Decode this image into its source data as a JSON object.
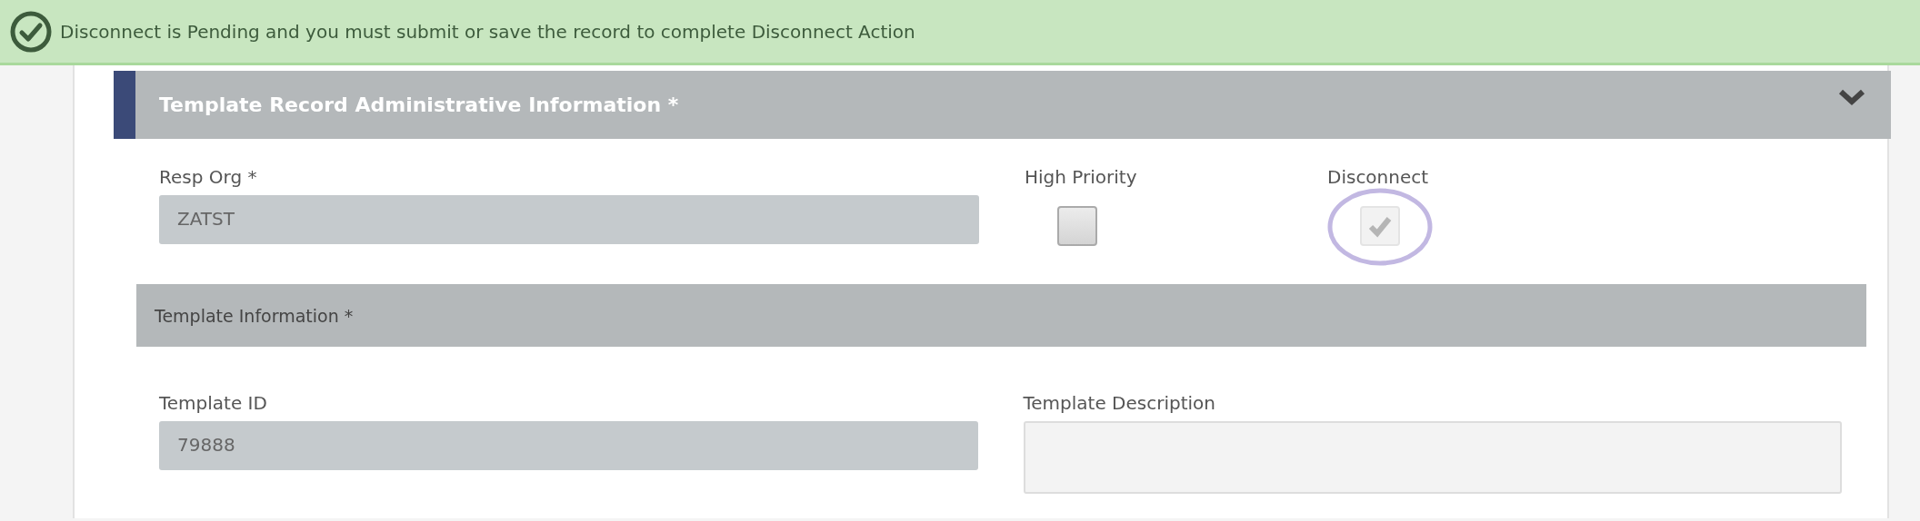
{
  "banner": {
    "message": "Disconnect is Pending and you must submit or save the record to complete Disconnect Action"
  },
  "section": {
    "title": "Template Record Administrative Information *",
    "expanded": true,
    "resp_org": {
      "label": "Resp Org *",
      "value": "ZATST"
    },
    "checkboxes": [
      {
        "label": "High Priority",
        "checked": false,
        "disabled": false,
        "highlighted": false
      },
      {
        "label": "Disconnect",
        "checked": true,
        "disabled": true,
        "highlighted": true
      }
    ]
  },
  "subsection": {
    "title": "Template Information *",
    "template_id": {
      "label": "Template ID",
      "value": "79888"
    },
    "template_description": {
      "label": "Template Description"
    }
  }
}
